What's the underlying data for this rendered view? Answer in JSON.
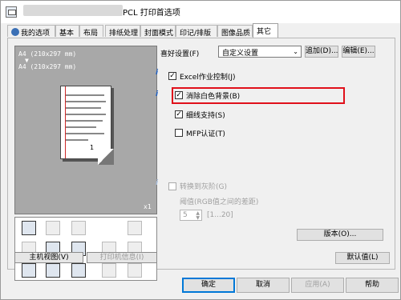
{
  "window": {
    "title": "PCL 打印首选项"
  },
  "tabs": [
    {
      "label": "我的选项",
      "icon": "user-icon"
    },
    {
      "label": "基本"
    },
    {
      "label": "布局"
    },
    {
      "label": "排纸处理"
    },
    {
      "label": "封面模式"
    },
    {
      "label": "印记/排版"
    },
    {
      "label": "图像品质"
    },
    {
      "label": "其它",
      "active": true
    }
  ],
  "preview": {
    "paper_line1": "A4 (210x297 mm)",
    "arrow": "▼",
    "paper_line2": "A4 (210x297 mm)",
    "copies_badge": "1",
    "scale": "x1"
  },
  "left_buttons": {
    "main_view": "主机视图(V)",
    "printer_info": "打印机信息(I)"
  },
  "favorites": {
    "label": "喜好设置(F)",
    "selected": "自定义设置",
    "add_label": "追加(D)...",
    "edit_label": "编辑(E)..."
  },
  "options": [
    {
      "label": "Excel作业控制(J)",
      "checked": true
    },
    {
      "label": "消除白色背景(B)",
      "checked": true,
      "highlighted": true
    },
    {
      "label": "细线支持(S)",
      "checked": true
    },
    {
      "label": "MFP认证(T)",
      "checked": false
    }
  ],
  "grayscale": {
    "label": "转换到灰阶(G)",
    "checked": false,
    "threshold_label": "阈值(RGB值之间的差距)",
    "threshold_value": "5",
    "threshold_range": "[1...20]"
  },
  "version_label": "版本(O)...",
  "default_label": "默认值(L)",
  "footer": {
    "ok": "确定",
    "cancel": "取消",
    "apply": "应用(A)",
    "help": "帮助"
  },
  "colors": {
    "highlight": "#e0101a",
    "accent": "#0078d7",
    "preview_bg": "#a8a8a8"
  }
}
